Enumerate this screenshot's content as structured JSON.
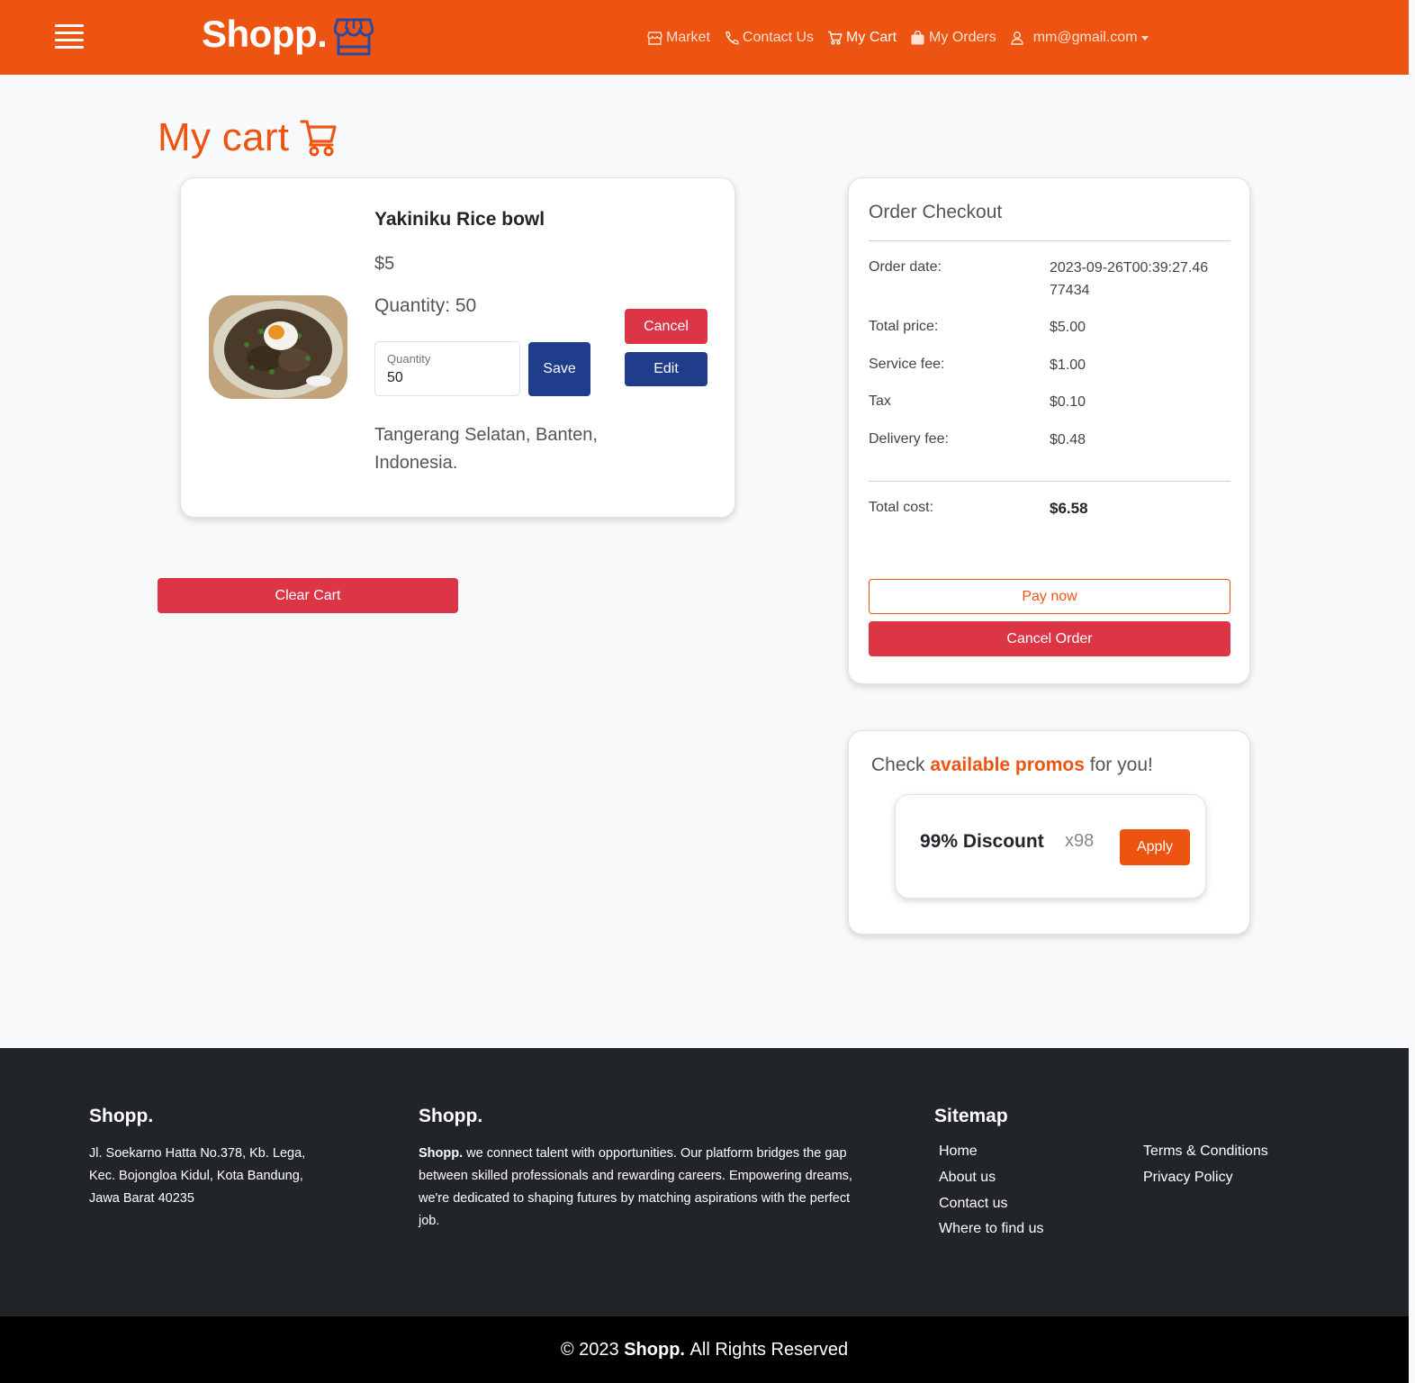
{
  "navbar": {
    "brand": "Shopp.",
    "links": [
      {
        "label": "Market",
        "icon": "store-icon"
      },
      {
        "label": "Contact Us",
        "icon": "phone-icon"
      },
      {
        "label": "My Cart",
        "icon": "cart-icon"
      },
      {
        "label": "My Orders",
        "icon": "bag-icon"
      },
      {
        "label": "mm@gmail.com",
        "icon": "user-icon"
      }
    ]
  },
  "page": {
    "title": "My cart"
  },
  "cart_item": {
    "name": "Yakiniku Rice bowl",
    "price": "$5",
    "quantity_text": "Quantity: 50",
    "quantity_field_label": "Quantity",
    "quantity_field_value": "50",
    "save_label": "Save",
    "cancel_label": "Cancel",
    "edit_label": "Edit",
    "address": "Tangerang Selatan, Banten, Indonesia."
  },
  "clear_cart_label": "Clear Cart",
  "checkout": {
    "title": "Order Checkout",
    "rows": [
      {
        "label": "Order date:",
        "value": "2023-09-26T00:39:27.4677434"
      },
      {
        "label": "Total price:",
        "value": "$5.00"
      },
      {
        "label": "Service fee:",
        "value": "$1.00"
      },
      {
        "label": "Tax",
        "value": "$0.10"
      },
      {
        "label": "Delivery fee:",
        "value": "$0.48"
      }
    ],
    "total_label": "Total cost:",
    "total_value": "$6.58",
    "pay_label": "Pay now",
    "cancel_order_label": "Cancel Order"
  },
  "promos": {
    "title_pre": "Check",
    "title_em": "available promos",
    "title_post": "for you!",
    "items": [
      {
        "name": "99% Discount",
        "count": "x98",
        "apply_label": "Apply"
      }
    ]
  },
  "footer": {
    "col1_title": "Shopp.",
    "col1_address": "Jl. Soekarno Hatta No.378, Kb. Lega, Kec. Bojongloa Kidul, Kota Bandung, Jawa Barat 40235",
    "col2_title": "Shopp.",
    "col2_brand": "Shopp.",
    "col2_text": "we connect talent with opportunities. Our platform bridges the gap between skilled professionals and rewarding careers. Empowering dreams, we're dedicated to shaping futures by matching aspirations with the perfect job.",
    "sitemap_title": "Sitemap",
    "sitemap_links": [
      "Home",
      "About us",
      "Contact us",
      "Where to find us"
    ],
    "legal_links": [
      "Terms & Conditions",
      "Privacy Policy"
    ],
    "copyright_pre": "© 2023",
    "copyright_brand": "Shopp.",
    "copyright_post": "All Rights Reserved"
  },
  "colors": {
    "brand": "#ee5411",
    "danger": "#dc3545",
    "primary": "#1f3d8a",
    "footer_bg": "#212529"
  }
}
